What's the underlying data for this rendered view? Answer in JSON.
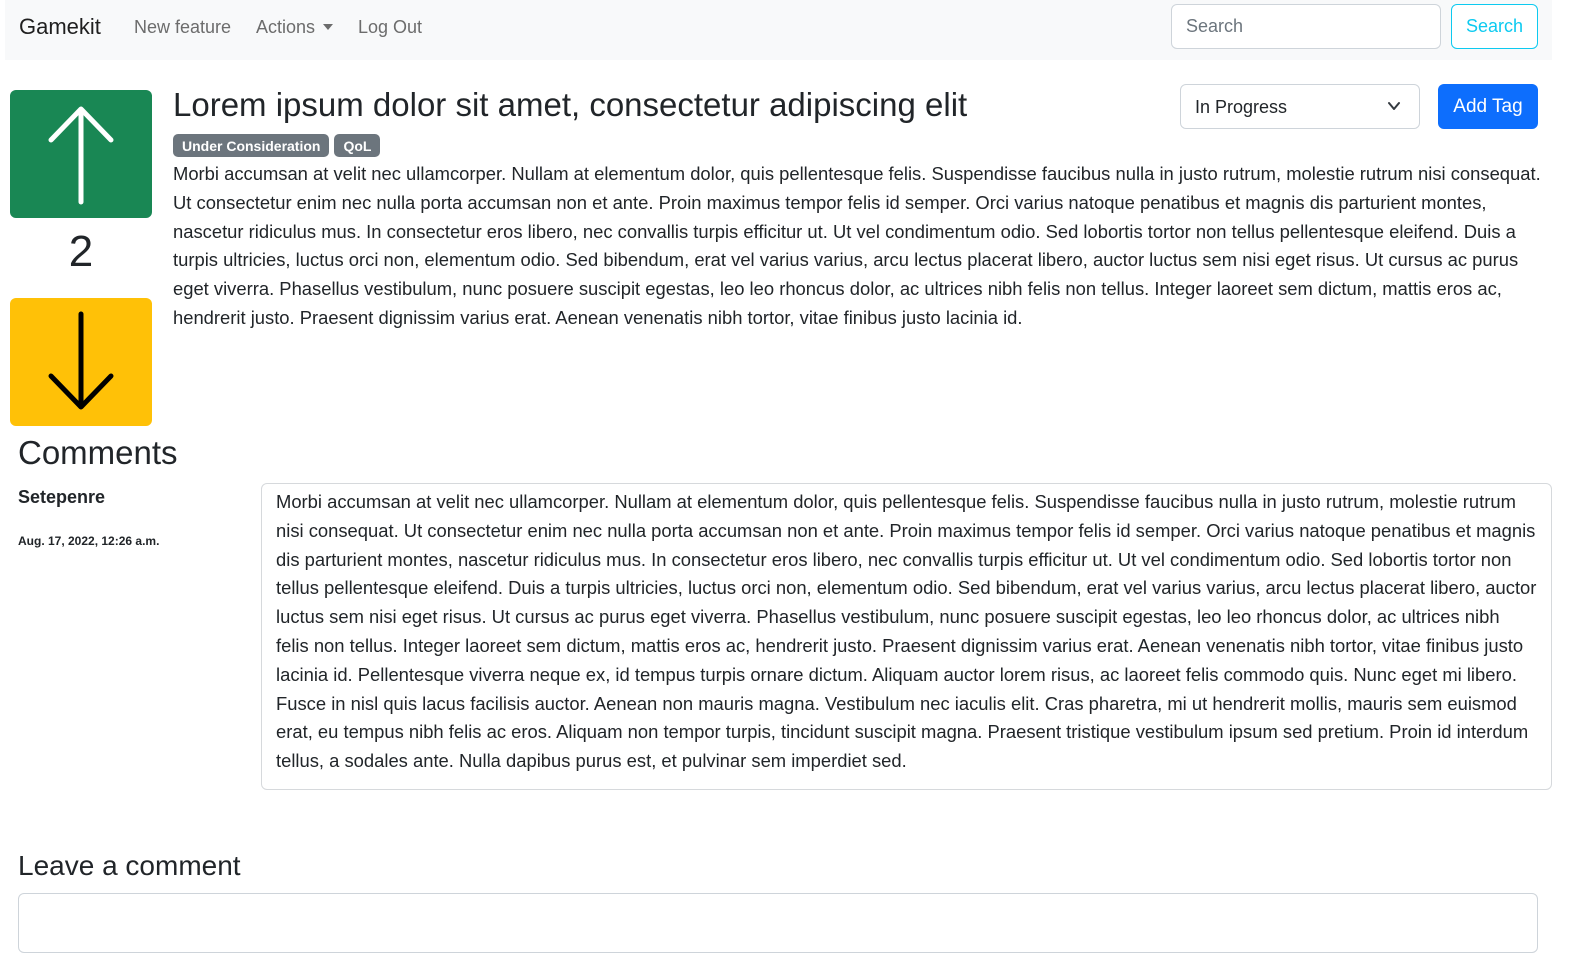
{
  "navbar": {
    "brand": "Gamekit",
    "links": [
      "New feature",
      "Actions",
      "Log Out"
    ],
    "search_placeholder": "Search",
    "search_button": "Search"
  },
  "vote": {
    "count": "2"
  },
  "post": {
    "title": "Lorem ipsum dolor sit amet, consectetur adipiscing elit",
    "status": "In Progress",
    "add_tag_label": "Add Tag",
    "tags": [
      "Under Consideration",
      "QoL"
    ],
    "body": "Morbi accumsan at velit nec ullamcorper. Nullam at elementum dolor, quis pellentesque felis. Suspendisse faucibus nulla in justo rutrum, molestie rutrum nisi consequat. Ut consectetur enim nec nulla porta accumsan non et ante. Proin maximus tempor felis id semper. Orci varius natoque penatibus et magnis dis parturient montes, nascetur ridiculus mus. In consectetur eros libero, nec convallis turpis efficitur ut. Ut vel condimentum odio. Sed lobortis tortor non tellus pellentesque eleifend. Duis a turpis ultricies, luctus orci non, elementum odio. Sed bibendum, erat vel varius varius, arcu lectus placerat libero, auctor luctus sem nisi eget risus. Ut cursus ac purus eget viverra. Phasellus vestibulum, nunc posuere suscipit egestas, leo leo rhoncus dolor, ac ultrices nibh felis non tellus. Integer laoreet sem dictum, mattis eros ac, hendrerit justo. Praesent dignissim varius erat. Aenean venenatis nibh tortor, vitae finibus justo lacinia id."
  },
  "comments": {
    "heading": "Comments",
    "items": [
      {
        "author": "Setepenre",
        "date": "Aug. 17, 2022, 12:26 a.m.",
        "text": "Morbi accumsan at velit nec ullamcorper. Nullam at elementum dolor, quis pellentesque felis. Suspendisse faucibus nulla in justo rutrum, molestie rutrum nisi consequat. Ut consectetur enim nec nulla porta accumsan non et ante. Proin maximus tempor felis id semper. Orci varius natoque penatibus et magnis dis parturient montes, nascetur ridiculus mus. In consectetur eros libero, nec convallis turpis efficitur ut. Ut vel condimentum odio. Sed lobortis tortor non tellus pellentesque eleifend. Duis a turpis ultricies, luctus orci non, elementum odio. Sed bibendum, erat vel varius varius, arcu lectus placerat libero, auctor luctus sem nisi eget risus. Ut cursus ac purus eget viverra. Phasellus vestibulum, nunc posuere suscipit egestas, leo leo rhoncus dolor, ac ultrices nibh felis non tellus. Integer laoreet sem dictum, mattis eros ac, hendrerit justo. Praesent dignissim varius erat. Aenean venenatis nibh tortor, vitae finibus justo lacinia id. Pellentesque viverra neque ex, id tempus turpis ornare dictum. Aliquam auctor lorem risus, ac laoreet felis commodo quis. Nunc eget mi libero. Fusce in nisl quis lacus facilisis auctor. Aenean non mauris magna. Vestibulum nec iaculis elit. Cras pharetra, mi ut hendrerit mollis, mauris sem euismod erat, eu tempus nibh felis ac eros. Aliquam non tempor turpis, tincidunt suscipit magna. Praesent tristique vestibulum ipsum sed pretium. Proin id interdum tellus, a sodales ante. Nulla dapibus purus est, et pulvinar sem imperdiet sed."
      }
    ],
    "leave_heading": "Leave a comment"
  },
  "icons": {
    "upvote": "arrow-up-icon",
    "downvote": "arrow-down-icon",
    "actions_caret": "caret-down-icon",
    "status_chevron": "chevron-down-icon"
  },
  "colors": {
    "upvote_bg": "#198754",
    "downvote_bg": "#ffc107",
    "primary": "#0d6efd",
    "info": "#0dcaf0",
    "badge": "#6c757d"
  }
}
